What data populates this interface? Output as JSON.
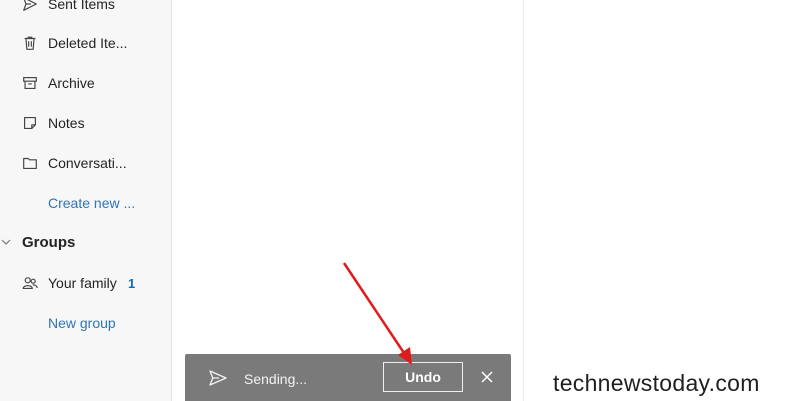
{
  "sidebar": {
    "items": [
      {
        "label": "Sent Items",
        "icon": "send-icon"
      },
      {
        "label": "Deleted Ite...",
        "icon": "trash-icon"
      },
      {
        "label": "Archive",
        "icon": "archive-icon"
      },
      {
        "label": "Notes",
        "icon": "note-icon"
      },
      {
        "label": "Conversati...",
        "icon": "folder-icon"
      }
    ],
    "create_new_label": "Create new ...",
    "groups": {
      "title": "Groups",
      "items": [
        {
          "label": "Your family",
          "count": "1",
          "icon": "people-icon"
        }
      ],
      "new_group_label": "New group"
    }
  },
  "toast": {
    "status_text": "Sending...",
    "undo_label": "Undo",
    "icon": "send-icon",
    "close_icon": "close-icon"
  },
  "watermark": "technewstoday.com",
  "colors": {
    "accent": "#0f6cbd",
    "link": "#2f74b6",
    "toast_bg": "#7a7a7a",
    "annotation_arrow": "#e01b1b"
  }
}
